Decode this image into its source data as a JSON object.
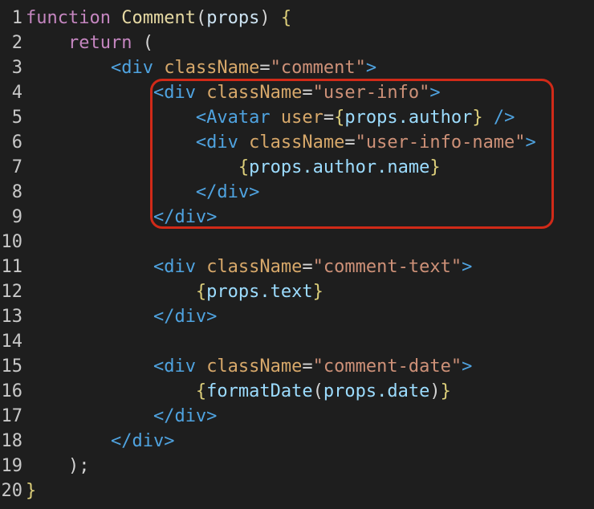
{
  "colors": {
    "background": "#1e1e1e",
    "line_number": "#c8c8c8",
    "keyword": "#c586c0",
    "function_name": "#e6d9a3",
    "param": "#cde3f2",
    "punctuation": "#d4d4d4",
    "brace": "#ddcf7a",
    "tag": "#4fa3e0",
    "attribute": "#d7a86a",
    "string": "#ce9178",
    "jsx_expr": "#9cdcfe",
    "highlight_box": "#d12a18"
  },
  "code": {
    "lines": [
      {
        "n": "1",
        "indent": 0,
        "tokens": [
          {
            "t": "function",
            "c": "keyword"
          },
          {
            "t": " ",
            "c": "punctuation"
          },
          {
            "t": "Comment",
            "c": "function_name"
          },
          {
            "t": "(",
            "c": "punctuation"
          },
          {
            "t": "props",
            "c": "param"
          },
          {
            "t": ") ",
            "c": "punctuation"
          },
          {
            "t": "{",
            "c": "brace"
          }
        ]
      },
      {
        "n": "2",
        "indent": 4,
        "tokens": [
          {
            "t": "return",
            "c": "keyword"
          },
          {
            "t": " (",
            "c": "punctuation"
          }
        ]
      },
      {
        "n": "3",
        "indent": 8,
        "tokens": [
          {
            "t": "<div",
            "c": "tag"
          },
          {
            "t": " ",
            "c": "punctuation"
          },
          {
            "t": "className",
            "c": "attribute"
          },
          {
            "t": "=",
            "c": "punctuation"
          },
          {
            "t": "\"comment\"",
            "c": "string"
          },
          {
            "t": ">",
            "c": "tag"
          }
        ]
      },
      {
        "n": "4",
        "indent": 12,
        "tokens": [
          {
            "t": "<div",
            "c": "tag"
          },
          {
            "t": " ",
            "c": "punctuation"
          },
          {
            "t": "className",
            "c": "attribute"
          },
          {
            "t": "=",
            "c": "punctuation"
          },
          {
            "t": "\"user-info\"",
            "c": "string"
          },
          {
            "t": ">",
            "c": "tag"
          }
        ]
      },
      {
        "n": "5",
        "indent": 16,
        "tokens": [
          {
            "t": "<Avatar",
            "c": "tag"
          },
          {
            "t": " ",
            "c": "punctuation"
          },
          {
            "t": "user",
            "c": "attribute"
          },
          {
            "t": "=",
            "c": "punctuation"
          },
          {
            "t": "{",
            "c": "brace"
          },
          {
            "t": "props.author",
            "c": "jsx_expr"
          },
          {
            "t": "}",
            "c": "brace"
          },
          {
            "t": " ",
            "c": "punctuation"
          },
          {
            "t": "/>",
            "c": "tag"
          }
        ]
      },
      {
        "n": "6",
        "indent": 16,
        "tokens": [
          {
            "t": "<div",
            "c": "tag"
          },
          {
            "t": " ",
            "c": "punctuation"
          },
          {
            "t": "className",
            "c": "attribute"
          },
          {
            "t": "=",
            "c": "punctuation"
          },
          {
            "t": "\"user-info-name\"",
            "c": "string"
          },
          {
            "t": ">",
            "c": "tag"
          }
        ]
      },
      {
        "n": "7",
        "indent": 20,
        "tokens": [
          {
            "t": "{",
            "c": "brace"
          },
          {
            "t": "props.author.name",
            "c": "jsx_expr"
          },
          {
            "t": "}",
            "c": "brace"
          }
        ]
      },
      {
        "n": "8",
        "indent": 16,
        "tokens": [
          {
            "t": "</div>",
            "c": "tag"
          }
        ]
      },
      {
        "n": "9",
        "indent": 12,
        "tokens": [
          {
            "t": "</div>",
            "c": "tag"
          }
        ]
      },
      {
        "n": "10",
        "indent": 0,
        "tokens": []
      },
      {
        "n": "11",
        "indent": 12,
        "tokens": [
          {
            "t": "<div",
            "c": "tag"
          },
          {
            "t": " ",
            "c": "punctuation"
          },
          {
            "t": "className",
            "c": "attribute"
          },
          {
            "t": "=",
            "c": "punctuation"
          },
          {
            "t": "\"comment-text\"",
            "c": "string"
          },
          {
            "t": ">",
            "c": "tag"
          }
        ]
      },
      {
        "n": "12",
        "indent": 16,
        "tokens": [
          {
            "t": "{",
            "c": "brace"
          },
          {
            "t": "props.text",
            "c": "jsx_expr"
          },
          {
            "t": "}",
            "c": "brace"
          }
        ]
      },
      {
        "n": "13",
        "indent": 12,
        "tokens": [
          {
            "t": "</div>",
            "c": "tag"
          }
        ]
      },
      {
        "n": "14",
        "indent": 0,
        "tokens": []
      },
      {
        "n": "15",
        "indent": 12,
        "tokens": [
          {
            "t": "<div",
            "c": "tag"
          },
          {
            "t": " ",
            "c": "punctuation"
          },
          {
            "t": "className",
            "c": "attribute"
          },
          {
            "t": "=",
            "c": "punctuation"
          },
          {
            "t": "\"comment-date\"",
            "c": "string"
          },
          {
            "t": ">",
            "c": "tag"
          }
        ]
      },
      {
        "n": "16",
        "indent": 16,
        "tokens": [
          {
            "t": "{",
            "c": "brace"
          },
          {
            "t": "formatDate",
            "c": "jsx_expr"
          },
          {
            "t": "(",
            "c": "punctuation"
          },
          {
            "t": "props.date",
            "c": "jsx_expr"
          },
          {
            "t": ")",
            "c": "punctuation"
          },
          {
            "t": "}",
            "c": "brace"
          }
        ]
      },
      {
        "n": "17",
        "indent": 12,
        "tokens": [
          {
            "t": "</div>",
            "c": "tag"
          }
        ]
      },
      {
        "n": "18",
        "indent": 8,
        "tokens": [
          {
            "t": "</div>",
            "c": "tag"
          }
        ]
      },
      {
        "n": "19",
        "indent": 4,
        "tokens": [
          {
            "t": ");",
            "c": "punctuation"
          }
        ]
      },
      {
        "n": "20",
        "indent": 0,
        "tokens": [
          {
            "t": "}",
            "c": "brace"
          }
        ]
      }
    ]
  },
  "annotation": {
    "highlight_lines": [
      "4",
      "9"
    ]
  }
}
